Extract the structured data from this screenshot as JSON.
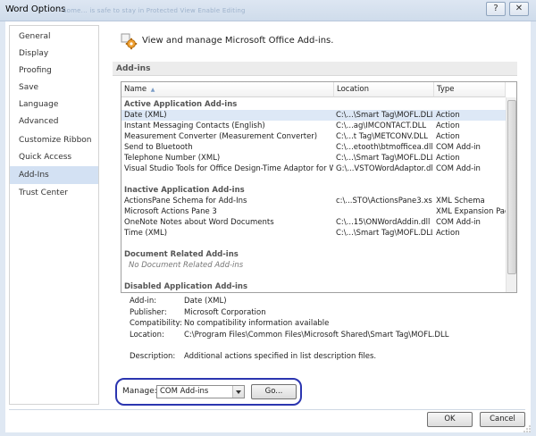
{
  "window": {
    "title": "Word Options",
    "ghost_text": "Some... is safe to stay in Protected View          Enable Editing",
    "help_label": "?",
    "close_label": "✕"
  },
  "nav": {
    "items": [
      {
        "label": "General",
        "selected": false
      },
      {
        "label": "Display",
        "selected": false
      },
      {
        "label": "Proofing",
        "selected": false
      },
      {
        "label": "Save",
        "selected": false
      },
      {
        "label": "Language",
        "selected": false
      },
      {
        "label": "Advanced",
        "selected": false
      },
      {
        "label": "Customize Ribbon",
        "selected": false
      },
      {
        "label": "Quick Access Toolbar",
        "selected": false
      },
      {
        "label": "Add-Ins",
        "selected": true
      },
      {
        "label": "Trust Center",
        "selected": false
      }
    ]
  },
  "header": {
    "title": "View and manage Microsoft Office Add-ins.",
    "icon": "addins-gear-icon"
  },
  "section": {
    "title": "Add-ins"
  },
  "table": {
    "columns": {
      "name": "Name",
      "name_sort": "▲",
      "location": "Location",
      "type": "Type"
    },
    "groups": {
      "active": {
        "title": "Active Application Add-ins",
        "rows": [
          {
            "name": "Date (XML)",
            "location": "C:\\...\\Smart Tag\\MOFL.DLL",
            "type": "Action",
            "selected": true
          },
          {
            "name": "Instant Messaging Contacts (English)",
            "location": "C:\\...ag\\IMCONTACT.DLL",
            "type": "Action"
          },
          {
            "name": "Measurement Converter (Measurement Converter)",
            "location": "C:\\...t Tag\\METCONV.DLL",
            "type": "Action"
          },
          {
            "name": "Send to Bluetooth",
            "location": "C:\\...etooth\\btmofficea.dll",
            "type": "COM Add-in"
          },
          {
            "name": "Telephone Number (XML)",
            "location": "C:\\...\\Smart Tag\\MOFL.DLL",
            "type": "Action"
          },
          {
            "name": "Visual Studio Tools for Office Design-Time Adaptor for Word",
            "location": "G:\\...VSTOWordAdaptor.dll",
            "type": "COM Add-in"
          }
        ]
      },
      "inactive": {
        "title": "Inactive Application Add-ins",
        "rows": [
          {
            "name": "ActionsPane Schema for Add-Ins",
            "location": "c:\\...STO\\ActionsPane3.xsd",
            "type": "XML Schema"
          },
          {
            "name": "Microsoft Actions Pane 3",
            "location": "",
            "type": "XML Expansion Pack"
          },
          {
            "name": "OneNote Notes about Word Documents",
            "location": "C:\\...15\\ONWordAddin.dll",
            "type": "COM Add-in"
          },
          {
            "name": "Time (XML)",
            "location": "C:\\...\\Smart Tag\\MOFL.DLL",
            "type": "Action"
          }
        ]
      },
      "document": {
        "title": "Document Related Add-ins",
        "empty": "No Document Related Add-ins"
      },
      "disabled": {
        "title": "Disabled Application Add-ins"
      }
    }
  },
  "details": {
    "addin": {
      "label": "Add-in:",
      "value": "Date (XML)"
    },
    "publisher": {
      "label": "Publisher:",
      "value": "Microsoft Corporation"
    },
    "compatibility": {
      "label": "Compatibility:",
      "value": "No compatibility information available"
    },
    "location": {
      "label": "Location:",
      "value": "C:\\Program Files\\Common Files\\Microsoft Shared\\Smart Tag\\MOFL.DLL"
    },
    "description": {
      "label": "Description:",
      "value": "Additional actions specified in list description files."
    }
  },
  "manage": {
    "label": "Manage:",
    "selected": "COM Add-ins",
    "go_label": "Go...",
    "highlight_color": "#2b35b0"
  },
  "footer": {
    "ok_label": "OK",
    "cancel_label": "Cancel"
  },
  "colors": {
    "nav_selected": "#d3e1f3",
    "row_selected": "#dde8f6"
  }
}
